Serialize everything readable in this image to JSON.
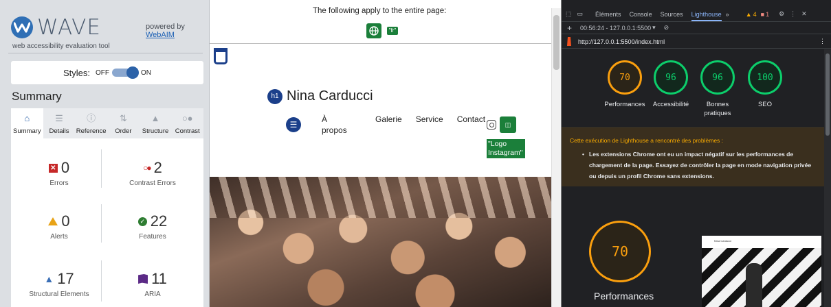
{
  "wave": {
    "logo_text": "WAVE",
    "subtitle": "web accessibility evaluation tool",
    "powered_by": "powered by",
    "powered_link": "WebAIM",
    "styles_label": "Styles:",
    "styles_off": "OFF",
    "styles_on": "ON",
    "summary_title": "Summary",
    "tabs": [
      {
        "label": "Summary",
        "icon": "home-icon"
      },
      {
        "label": "Details",
        "icon": "list-icon"
      },
      {
        "label": "Reference",
        "icon": "info-icon"
      },
      {
        "label": "Order",
        "icon": "order-icon"
      },
      {
        "label": "Structure",
        "icon": "structure-icon"
      },
      {
        "label": "Contrast",
        "icon": "contrast-icon"
      }
    ],
    "stats": {
      "errors": {
        "value": "0",
        "label": "Errors"
      },
      "contrast_errors": {
        "value": "2",
        "label": "Contrast Errors"
      },
      "alerts": {
        "value": "0",
        "label": "Alerts"
      },
      "features": {
        "value": "22",
        "label": "Features"
      },
      "structural": {
        "value": "17",
        "label": "Structural Elements"
      },
      "aria": {
        "value": "11",
        "label": "ARIA"
      }
    }
  },
  "preview": {
    "notice": "The following apply to the entire page:",
    "lang_badge": "\"fr\"",
    "h1_badge": "h1",
    "site_title": "Nina Carducci",
    "nav": [
      "À propos",
      "Galerie",
      "Service",
      "Contact"
    ],
    "logo_alt": "\"Logo Instagram\""
  },
  "devtools": {
    "tabs": [
      "Éléments",
      "Console",
      "Sources",
      "Lighthouse"
    ],
    "more": "»",
    "warnings": "4",
    "errors": "1",
    "session": "00:56:24 - 127.0.0.1:5500",
    "url": "http://127.0.0.1:5500/index.html",
    "scores": [
      {
        "value": "70",
        "label": "Performances",
        "color": "#fa9f0e"
      },
      {
        "value": "96",
        "label": "Accessibilité",
        "color": "#0cce6b"
      },
      {
        "value": "96",
        "label": "Bonnes pratiques",
        "color": "#0cce6b"
      },
      {
        "value": "100",
        "label": "SEO",
        "color": "#0cce6b"
      }
    ],
    "warning_title": "Cette exécution de Lighthouse a rencontré des problèmes :",
    "warning_text": "Les extensions Chrome ont eu un impact négatif sur les performances de chargement de la page. Essayez de contrôler la page en mode navigation privée ou depuis un profil Chrome sans extensions.",
    "big_score": "70",
    "big_label": "Performances",
    "thumb_title": "Nina Carducci"
  }
}
